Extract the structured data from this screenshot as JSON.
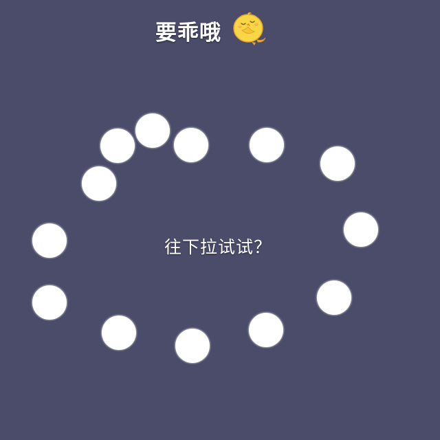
{
  "header": {
    "title": "要乖哦",
    "icon": "chick-emoji-icon"
  },
  "center": {
    "prompt": "往下拉试试？"
  },
  "dots": {
    "count": 13,
    "icon": "white-circle"
  },
  "colors": {
    "background": "#4a4c6a",
    "dots": "#ffffff",
    "text": "#ffffff",
    "chick_body": "#f8d646",
    "chick_outline": "#e2a52a"
  }
}
